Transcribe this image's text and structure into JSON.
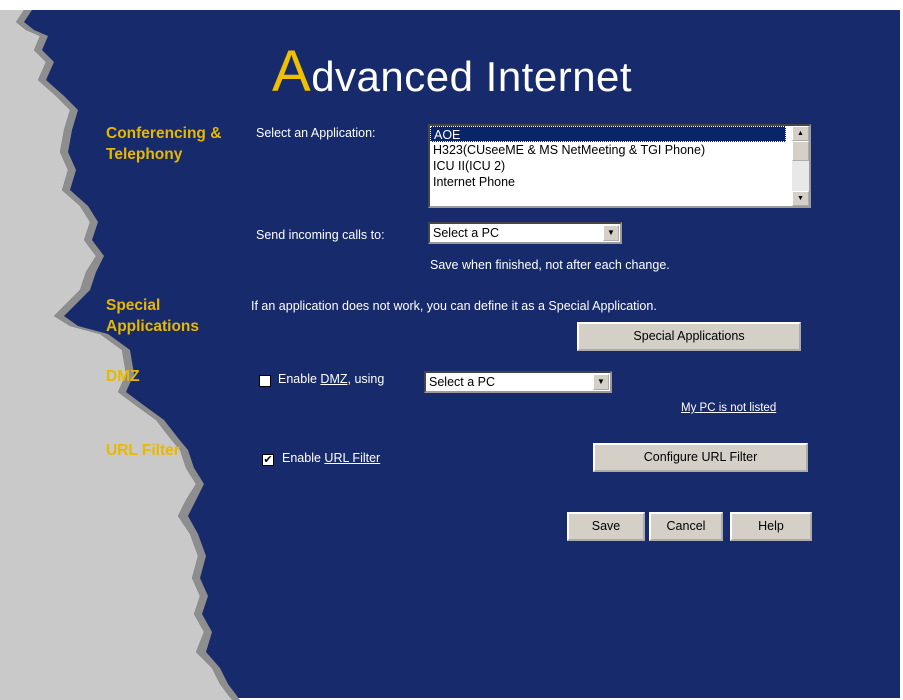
{
  "header": {
    "title_initial": "A",
    "title_rest": "dvanced Internet"
  },
  "sections": {
    "conferencing": "Conferencing & Telephony",
    "special": "Special Applications",
    "dmz": "DMZ",
    "url_filter": "URL Filter"
  },
  "conferencing": {
    "select_app_label": "Select an Application:",
    "applications": [
      "AOE",
      "H323(CUseeME & MS NetMeeting & TGI Phone)",
      "ICU II(ICU 2)",
      "Internet Phone"
    ],
    "selected_application": "AOE",
    "send_calls_label": "Send incoming calls to:",
    "send_calls_value": "Select a PC",
    "save_note": "Save when finished, not after each change."
  },
  "special": {
    "description": "If an application does not work, you can define it as a Special Application.",
    "button_label": "Special Applications"
  },
  "dmz": {
    "enable_prefix": "Enable",
    "link_label": "DMZ",
    "using_suffix": ", using",
    "select_value": "Select a PC",
    "checked": false,
    "not_listed_link": "My PC is not listed"
  },
  "url_filter": {
    "enable_prefix": "Enable",
    "link_label": "URL Filter",
    "checked": true,
    "configure_button": "Configure URL Filter"
  },
  "actions": {
    "save": "Save",
    "cancel": "Cancel",
    "help": "Help"
  },
  "icons": {
    "dropdown": "chevron-down-icon",
    "scroll_up": "scroll-up-arrow-icon",
    "scroll_down": "scroll-down-arrow-icon",
    "check": "checkmark-icon"
  },
  "colors": {
    "background": "#172a6b",
    "accent": "#f0c000",
    "section_heading": "#e8b800",
    "selection": "#0a246a"
  }
}
